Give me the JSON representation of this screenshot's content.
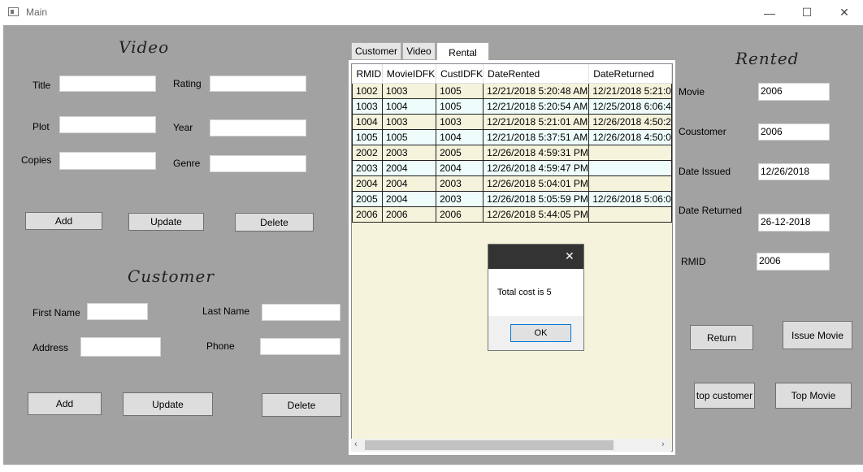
{
  "window": {
    "title": "Main",
    "minimize": "—",
    "maximize": "☐",
    "close": "✕"
  },
  "video": {
    "heading": "Video",
    "title_label": "Title",
    "rating_label": "Rating",
    "plot_label": "Plot",
    "year_label": "Year",
    "copies_label": "Copies",
    "genre_label": "Genre",
    "title_value": "",
    "rating_value": "",
    "plot_value": "",
    "year_value": "",
    "copies_value": "",
    "genre_value": "",
    "add": "Add",
    "update": "Update",
    "delete": "Delete"
  },
  "customer": {
    "heading": "Customer",
    "first_name_label": "First Name",
    "last_name_label": "Last Name",
    "address_label": "Address",
    "phone_label": "Phone",
    "first_name_value": "",
    "last_name_value": "",
    "address_value": "",
    "phone_value": "",
    "add": "Add",
    "update": "Update",
    "delete": "Delete"
  },
  "tabs": [
    "Customer",
    "Video",
    "Rental"
  ],
  "grid": {
    "columns": [
      "RMID",
      "MovieIDFK",
      "CustIDFK",
      "DateRented",
      "DateReturned"
    ],
    "rows": [
      [
        "1002",
        "1003",
        "1005",
        "12/21/2018 5:20:48 AM",
        "12/21/2018 5:21:0"
      ],
      [
        "1003",
        "1004",
        "1005",
        "12/21/2018 5:20:54 AM",
        "12/25/2018 6:06:4"
      ],
      [
        "1004",
        "1003",
        "1003",
        "12/21/2018 5:21:01 AM",
        "12/26/2018 4:50:2"
      ],
      [
        "1005",
        "1005",
        "1004",
        "12/21/2018 5:37:51 AM",
        "12/26/2018 4:50:0"
      ],
      [
        "2002",
        "2003",
        "2005",
        "12/26/2018 4:59:31 PM",
        ""
      ],
      [
        "2003",
        "2004",
        "2004",
        "12/26/2018 4:59:47 PM",
        ""
      ],
      [
        "2004",
        "2004",
        "2003",
        "12/26/2018 5:04:01 PM",
        ""
      ],
      [
        "2005",
        "2004",
        "2003",
        "12/26/2018 5:05:59 PM",
        "12/26/2018 5:06:0"
      ],
      [
        "2006",
        "2006",
        "2006",
        "12/26/2018 5:44:05 PM",
        ""
      ]
    ]
  },
  "rented": {
    "heading": "Rented",
    "movie_label": "Movie",
    "movie_value": "2006",
    "customer_label": "Coustomer",
    "customer_value": "2006",
    "date_issued_label": "Date Issued",
    "date_issued_value": "12/26/2018",
    "date_returned_label": "Date Returned",
    "date_returned_value": "26-12-2018",
    "rmid_label": "RMID",
    "rmid_value": "2006",
    "return_btn": "Return",
    "issue_movie_btn": "Issue Movie",
    "top_customer_btn": "top customer",
    "top_movie_btn": "Top Movie"
  },
  "dialog": {
    "close": "✕",
    "message": "Total cost is 5",
    "ok": "OK"
  }
}
